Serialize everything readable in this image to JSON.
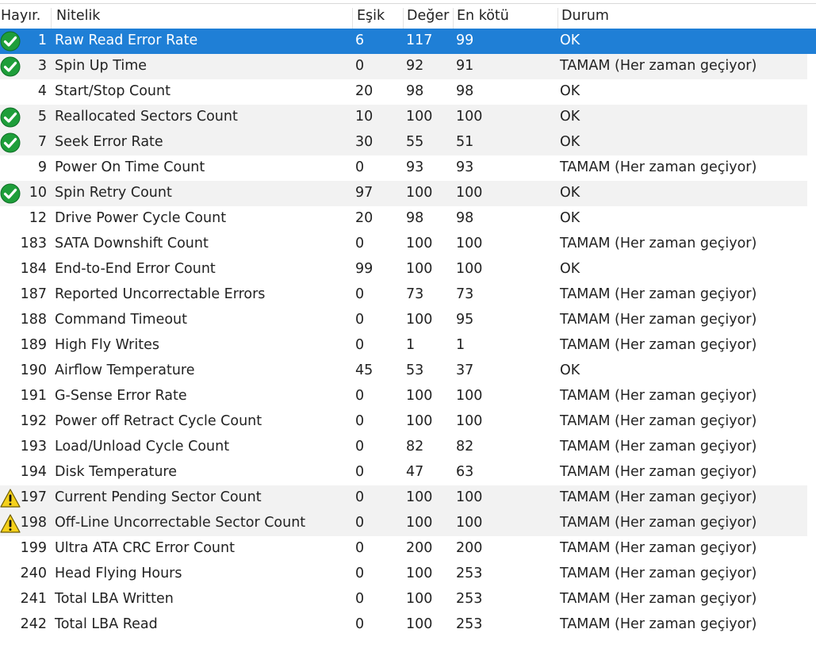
{
  "columns": {
    "no": "Hayır.",
    "attribute": "Nitelik",
    "threshold": "Eşik",
    "value": "Değer",
    "worst": "En kötü",
    "status": "Durum"
  },
  "rows": [
    {
      "no": "1",
      "name": "Raw Read Error Rate",
      "threshold": "6",
      "value": "117",
      "worst": "99",
      "status": "OK",
      "icon": "check-icon",
      "selected": true
    },
    {
      "no": "3",
      "name": "Spin Up Time",
      "threshold": "0",
      "value": "92",
      "worst": "91",
      "status": "TAMAM (Her zaman geçiyor)",
      "icon": "check-icon"
    },
    {
      "no": "4",
      "name": "Start/Stop Count",
      "threshold": "20",
      "value": "98",
      "worst": "98",
      "status": "OK",
      "icon": ""
    },
    {
      "no": "5",
      "name": "Reallocated Sectors Count",
      "threshold": "10",
      "value": "100",
      "worst": "100",
      "status": "OK",
      "icon": "check-icon"
    },
    {
      "no": "7",
      "name": "Seek Error Rate",
      "threshold": "30",
      "value": "55",
      "worst": "51",
      "status": "OK",
      "icon": "check-icon"
    },
    {
      "no": "9",
      "name": "Power On Time Count",
      "threshold": "0",
      "value": "93",
      "worst": "93",
      "status": "TAMAM (Her zaman geçiyor)",
      "icon": ""
    },
    {
      "no": "10",
      "name": "Spin Retry Count",
      "threshold": "97",
      "value": "100",
      "worst": "100",
      "status": "OK",
      "icon": "check-icon"
    },
    {
      "no": "12",
      "name": "Drive Power Cycle Count",
      "threshold": "20",
      "value": "98",
      "worst": "98",
      "status": "OK",
      "icon": ""
    },
    {
      "no": "183",
      "name": "SATA Downshift Count",
      "threshold": "0",
      "value": "100",
      "worst": "100",
      "status": "TAMAM (Her zaman geçiyor)",
      "icon": ""
    },
    {
      "no": "184",
      "name": "End-to-End Error Count",
      "threshold": "99",
      "value": "100",
      "worst": "100",
      "status": "OK",
      "icon": ""
    },
    {
      "no": "187",
      "name": "Reported Uncorrectable Errors",
      "threshold": "0",
      "value": "73",
      "worst": "73",
      "status": "TAMAM (Her zaman geçiyor)",
      "icon": ""
    },
    {
      "no": "188",
      "name": "Command Timeout",
      "threshold": "0",
      "value": "100",
      "worst": "95",
      "status": "TAMAM (Her zaman geçiyor)",
      "icon": ""
    },
    {
      "no": "189",
      "name": "High Fly Writes",
      "threshold": "0",
      "value": "1",
      "worst": "1",
      "status": "TAMAM (Her zaman geçiyor)",
      "icon": ""
    },
    {
      "no": "190",
      "name": "Airflow Temperature",
      "threshold": "45",
      "value": "53",
      "worst": "37",
      "status": "OK",
      "icon": ""
    },
    {
      "no": "191",
      "name": "G-Sense Error Rate",
      "threshold": "0",
      "value": "100",
      "worst": "100",
      "status": "TAMAM (Her zaman geçiyor)",
      "icon": ""
    },
    {
      "no": "192",
      "name": "Power off Retract Cycle Count",
      "threshold": "0",
      "value": "100",
      "worst": "100",
      "status": "TAMAM (Her zaman geçiyor)",
      "icon": ""
    },
    {
      "no": "193",
      "name": "Load/Unload Cycle Count",
      "threshold": "0",
      "value": "82",
      "worst": "82",
      "status": "TAMAM (Her zaman geçiyor)",
      "icon": ""
    },
    {
      "no": "194",
      "name": "Disk Temperature",
      "threshold": "0",
      "value": "47",
      "worst": "63",
      "status": "TAMAM (Her zaman geçiyor)",
      "icon": ""
    },
    {
      "no": "197",
      "name": "Current Pending Sector Count",
      "threshold": "0",
      "value": "100",
      "worst": "100",
      "status": "TAMAM (Her zaman geçiyor)",
      "icon": "warning-icon"
    },
    {
      "no": "198",
      "name": "Off-Line Uncorrectable Sector Count",
      "threshold": "0",
      "value": "100",
      "worst": "100",
      "status": "TAMAM (Her zaman geçiyor)",
      "icon": "warning-icon"
    },
    {
      "no": "199",
      "name": "Ultra ATA CRC Error Count",
      "threshold": "0",
      "value": "200",
      "worst": "200",
      "status": "TAMAM (Her zaman geçiyor)",
      "icon": ""
    },
    {
      "no": "240",
      "name": "Head Flying Hours",
      "threshold": "0",
      "value": "100",
      "worst": "253",
      "status": "TAMAM (Her zaman geçiyor)",
      "icon": ""
    },
    {
      "no": "241",
      "name": "Total LBA Written",
      "threshold": "0",
      "value": "100",
      "worst": "253",
      "status": "TAMAM (Her zaman geçiyor)",
      "icon": ""
    },
    {
      "no": "242",
      "name": "Total LBA Read",
      "threshold": "0",
      "value": "100",
      "worst": "253",
      "status": "TAMAM (Her zaman geçiyor)",
      "icon": ""
    }
  ],
  "colors": {
    "selection": "#1f7fd6",
    "alt_row": "#f2f2f2",
    "check_green": "#1e9e3a",
    "warning_yellow": "#f5d11a"
  }
}
